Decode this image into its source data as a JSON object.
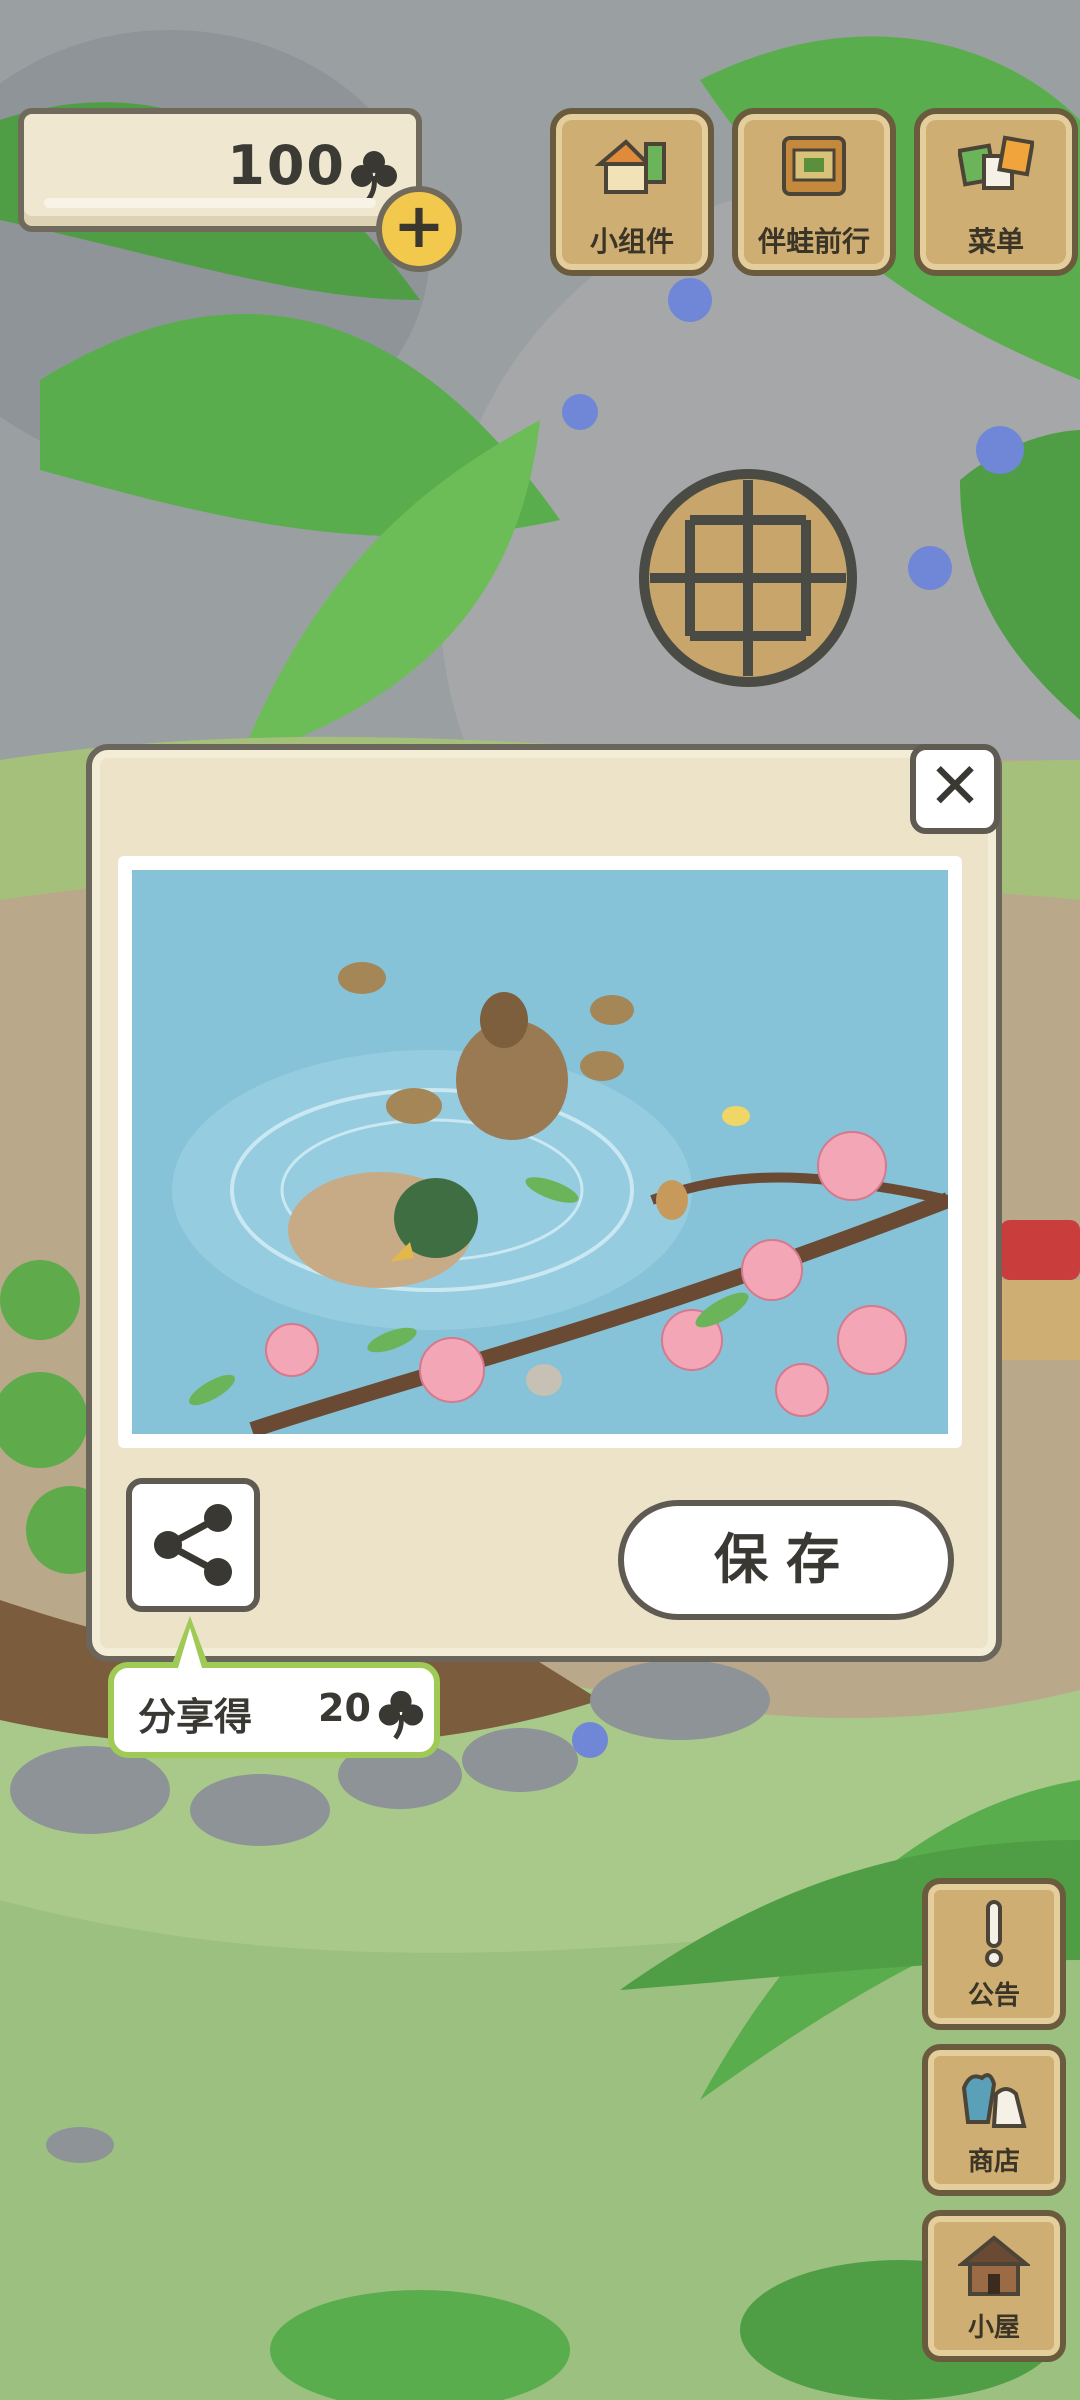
{
  "hud": {
    "clover_amount": "100",
    "add_label": "+"
  },
  "top_buttons": [
    {
      "id": "widgets",
      "label": "小组件",
      "icon": "widget-icon"
    },
    {
      "id": "travel",
      "label": "伴蛙前行",
      "icon": "travel-book-icon"
    },
    {
      "id": "menu",
      "label": "菜单",
      "icon": "menu-cards-icon"
    }
  ],
  "side_buttons": [
    {
      "id": "notice",
      "label": "公告",
      "icon": "exclamation-icon"
    },
    {
      "id": "shop",
      "label": "商店",
      "icon": "shop-bag-icon"
    },
    {
      "id": "house",
      "label": "小屋",
      "icon": "house-icon"
    }
  ],
  "dialog": {
    "close_label": "✕",
    "save_label": "保存",
    "share_tip_text": "分享得",
    "share_tip_amount": "20"
  },
  "colors": {
    "panel_bg": "#ece3c8",
    "wood_button": "#cfae73",
    "tip_border": "#9fca56",
    "coin_yellow": "#f3c94d"
  }
}
